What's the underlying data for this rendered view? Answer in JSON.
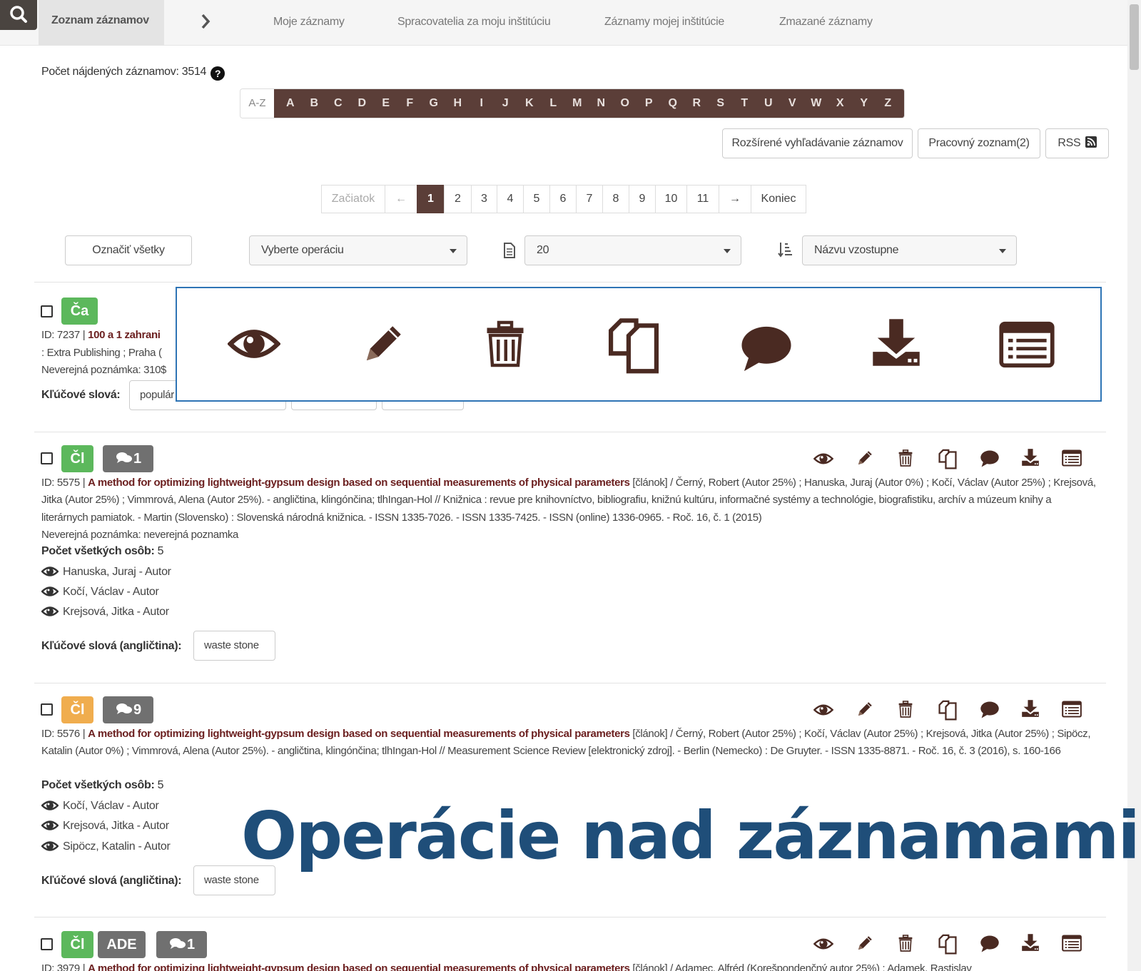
{
  "nav": {
    "tabs": [
      "Zoznam záznamov",
      "Moje záznamy",
      "Spracovatelia za moju inštitúciu",
      "Záznamy mojej inštitúcie",
      "Zmazané záznamy"
    ]
  },
  "count_label": "Počet nájdených záznamov: 3514",
  "help_glyph": "?",
  "alphabet": {
    "all": "A-Z",
    "letters": [
      "A",
      "B",
      "C",
      "D",
      "E",
      "F",
      "G",
      "H",
      "I",
      "J",
      "K",
      "L",
      "M",
      "N",
      "O",
      "P",
      "Q",
      "R",
      "S",
      "T",
      "U",
      "V",
      "W",
      "X",
      "Y",
      "Z"
    ]
  },
  "toolbar": {
    "advanced_search": "Rozšírené vyhľadávanie záznamov",
    "work_list": "Pracovný zoznam(2)",
    "rss": "RSS"
  },
  "pager": {
    "first": "Začiatok",
    "prev": "←",
    "pages": [
      "1",
      "2",
      "3",
      "4",
      "5",
      "6",
      "7",
      "8",
      "9",
      "10",
      "11"
    ],
    "current": "1",
    "next": "→",
    "last": "Koniec"
  },
  "controls": {
    "select_all": "Označiť všetky",
    "operation": "Vyberte operáciu",
    "per_page": "20",
    "sort": "Názvu vzostupne"
  },
  "records": [
    {
      "badge": "Ča",
      "line1_pre": "ID: 7237 | ",
      "line1_bold": "100 a 1 zahrani",
      "line2": ": Extra Publishing ; Praha (",
      "line3": "Neverejná poznámka: 310$",
      "kw_label": "Kľúčové slová:",
      "kw": "populár"
    },
    {
      "badge": "Čl",
      "comments": "1",
      "id": "ID: 5575 | ",
      "title": "A method for optimizing lightweight-gypsum design based on sequential measurements of physical parameters",
      "rest": " [článok] / Černý, Robert (Autor 25%) ; Hanuska, Juraj (Autor 0%) ; Kočí, Václav (Autor 25%) ; Krejsová, Jitka (Autor 25%) ; Vimmrová, Alena (Autor 25%). - angličtina, klingónčina; tlhIngan-Hol // Knižnica : revue pre knihovníctvo, bibliografiu, knižnú kultúru, informačné systémy a technológie, biografistiku, archív a múzeum knihy a literárnych pamiatok. - Martin (Slovensko) : Slovenská národná knižnica. - ISSN 1335-7026. - ISSN 1335-7425. - ISSN (online) 1336-0965. - Roč. 16, č. 1 (2015)",
      "note": "Neverejná poznámka: neverejná poznamka",
      "persons_label": "Počet všetkých osôb:",
      "persons_count": "5",
      "persons": [
        "Hanuska, Juraj - Autor",
        "Kočí, Václav - Autor",
        "Krejsová, Jitka - Autor"
      ],
      "kw_label": "Kľúčové slová (angličtina):",
      "kw": "waste stone"
    },
    {
      "badge": "Čl",
      "comments": "9",
      "id": "ID: 5576 | ",
      "title": "A method for optimizing lightweight-gypsum design based on sequential measurements of physical parameters",
      "rest": " [článok] / Černý, Robert (Autor 25%) ; Kočí, Václav (Autor 25%) ; Krejsová, Jitka (Autor 25%) ; Sipöcz, Katalin (Autor 0%) ; Vimmrová, Alena (Autor 25%). - angličtina, klingónčina; tlhIngan-Hol // Measurement Science Review [elektronický zdroj]. - Berlin (Nemecko) : De Gruyter. - ISSN 1335-8871. - Roč. 16, č. 3 (2016), s. 160-166",
      "persons_label": "Počet všetkých osôb:",
      "persons_count": "5",
      "persons": [
        "Kočí, Václav - Autor",
        "Krejsová, Jitka - Autor",
        "Sipöcz, Katalin - Autor"
      ],
      "kw_label": "Kľúčové slová (angličtina):",
      "kw": "waste stone"
    },
    {
      "badge": "Čl",
      "badge2": "ADE",
      "comments": "1",
      "id": "ID: 3979 | ",
      "title": "A method for optimizing lightweight-gypsum design based on sequential measurements of physical parameters",
      "rest": " [článok] / Adamec, Alfréd (Korešpondenčný autor 25%) ; Adamek, Rastislav"
    }
  ],
  "overlay_icons": [
    "eye-icon",
    "pencil-icon",
    "trash-icon",
    "copy-icon",
    "comment-icon",
    "download-icon",
    "list-icon"
  ],
  "headline": "Operácie nad záznamami",
  "colors": {
    "brand_dark": "#5b3e38",
    "title_red": "#6b1f1f",
    "badge_green": "#5cb85c",
    "badge_orange": "#f0ad4e",
    "badge_grey": "#707070",
    "headline_blue": "#1f4e79",
    "overlay_border": "#2e74b5"
  }
}
